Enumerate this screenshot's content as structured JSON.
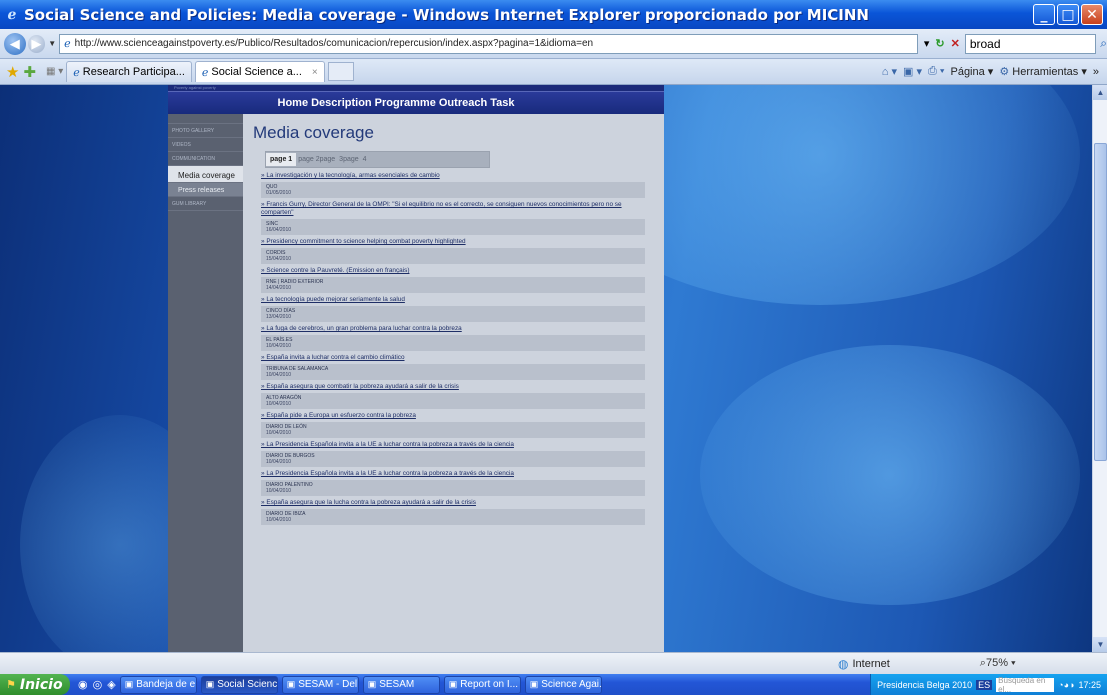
{
  "window": {
    "title": "Social Science and Policies: Media coverage - Windows Internet Explorer proporcionado por MICINN"
  },
  "address_bar": {
    "url": "http://www.scienceagainstpoverty.es/Publico/Resultados/comunicacion/repercusion/index.aspx?pagina=1&idioma=en",
    "search_value": "broad"
  },
  "tabs": [
    {
      "label": "Research Participa..."
    },
    {
      "label": "Social Science a..."
    }
  ],
  "command_bar": {
    "page_label": "Página",
    "tools_label": "Herramientas"
  },
  "site": {
    "top_text": "Poverty  against  poverty",
    "nav_text": "Home Description Programme Outreach Task",
    "left_nav": [
      {
        "label": "PHOTO GALLERY",
        "type": "plain"
      },
      {
        "label": "VIDEOS",
        "type": "plain"
      },
      {
        "label": "COMMUNICATION",
        "type": "plain"
      },
      {
        "label": "Media coverage",
        "type": "active"
      },
      {
        "label": "Press releases",
        "type": "sub"
      },
      {
        "label": "GUM LIBRARY",
        "type": "plain"
      }
    ],
    "heading": "Media coverage",
    "pager": {
      "current": "page 1",
      "others": [
        "page 2page",
        "3page",
        "4"
      ]
    },
    "items": [
      {
        "title": "» La investigación y la tecnología, armas esenciales de cambio",
        "source": "QUO",
        "date": "01/05/2010"
      },
      {
        "title": "» Francis Gurry, Director General de la OMPI: \"Si el equilibrio no es el correcto, se consiguen nuevos conocimientos pero no se comparten\"",
        "source": "SINC",
        "date": "16/04/2010"
      },
      {
        "title": "» Presidency commitment to science helping combat poverty highlighted",
        "source": "CORDIS",
        "date": "15/04/2010"
      },
      {
        "title": "» Science contre la Pauvreté. (Emission en français)",
        "source": "RNE | RADIO EXTERIOR",
        "date": "14/04/2010"
      },
      {
        "title": "» La tecnología puede mejorar seriamente la salud",
        "source": "CINCO DÍAS",
        "date": "13/04/2010"
      },
      {
        "title": "» La fuga de cerebros, un gran problema para luchar contra la pobreza",
        "source": "EL PAÍS.ES",
        "date": "10/04/2010"
      },
      {
        "title": "» España invita a luchar contra el cambio climático",
        "source": "TRIBUNA DE SALAMANCA",
        "date": "10/04/2010"
      },
      {
        "title": "» España asegura que combatir la pobreza ayudará a salir de la crisis",
        "source": "ALTO ARAGÓN",
        "date": "10/04/2010"
      },
      {
        "title": "» España pide a Europa un esfuerzo contra la pobreza",
        "source": "DIARIO DE LEÓN",
        "date": "10/04/2010"
      },
      {
        "title": "» La Presidencia Española invita a la UE a luchar contra la pobreza a través de la ciencia",
        "source": "DIARIO DE BURGOS",
        "date": "10/04/2010"
      },
      {
        "title": "» La Presidencia Española invita a la UE a luchar contra la pobreza a través de la ciencia",
        "source": "DIARIO PALENTINO",
        "date": "10/04/2010"
      },
      {
        "title": "» España asegura que la lucha contra la pobreza ayudará a salir de la crisis",
        "source": "DIARIO DE IBIZA",
        "date": "10/04/2010"
      }
    ]
  },
  "status_bar": {
    "zone": "Internet",
    "zoom": "75%"
  },
  "taskbar": {
    "start_label": "Inicio",
    "buttons": [
      {
        "label": "Bandeja de e...",
        "active": false
      },
      {
        "label": "Social Scienc...",
        "active": true
      },
      {
        "label": "SESAM - Del...",
        "active": false
      },
      {
        "label": "SESAM",
        "active": false
      },
      {
        "label": "Report on I...",
        "active": false
      },
      {
        "label": "Science Agai...",
        "active": false
      }
    ],
    "tray": {
      "extra": "Presidencia Belga 2010",
      "lang": "ES",
      "search_placeholder": "Búsqueda en el...",
      "clock": "17:25"
    }
  }
}
